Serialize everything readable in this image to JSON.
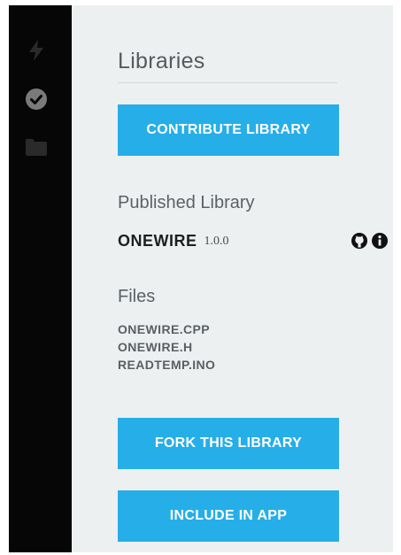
{
  "sidebar": {
    "icons": [
      "bolt-icon",
      "check-circle-icon",
      "folder-icon"
    ]
  },
  "panel": {
    "title": "Libraries",
    "contribute_label": "CONTRIBUTE LIBRARY",
    "published_heading": "Published Library",
    "library": {
      "name": "ONEWIRE",
      "version": "1.0.0",
      "icons": [
        "github-icon",
        "info-icon"
      ]
    },
    "files_heading": "Files",
    "files": [
      "ONEWIRE.CPP",
      "ONEWIRE.H",
      "READTEMP.INO"
    ],
    "fork_label": "FORK THIS LIBRARY",
    "include_label": "INCLUDE IN APP"
  },
  "colors": {
    "rail_background": "#060606",
    "panel_background": "#edf0f1",
    "accent_button": "#26aee8",
    "rail_icon_muted": "#2a2a2a",
    "rail_icon_active": "#7a7a7a"
  }
}
